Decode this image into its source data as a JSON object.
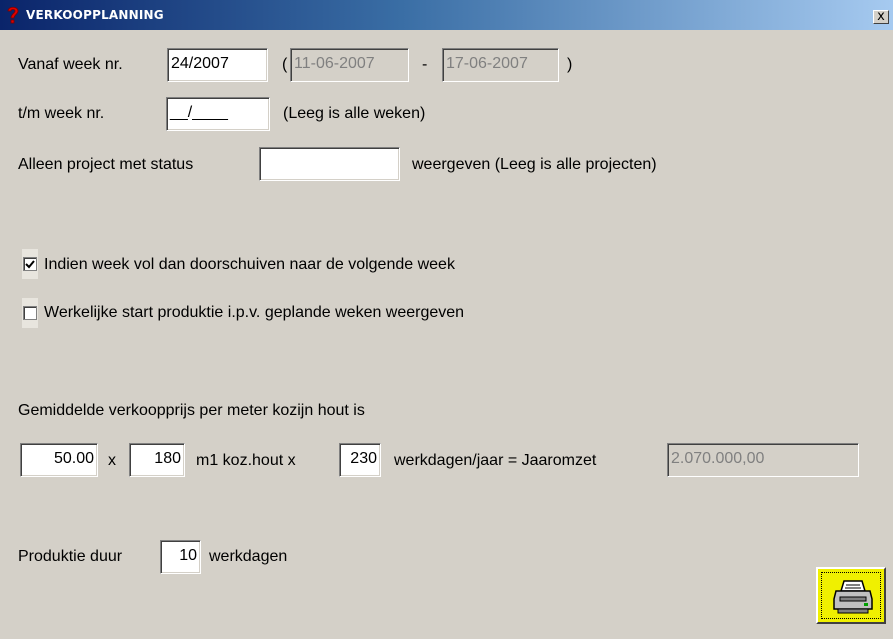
{
  "window": {
    "title": "VERKOOPPLANNING",
    "close_label": "x"
  },
  "week_from": {
    "label": "Vanaf week nr.",
    "value": "24/2007",
    "paren_open": "(",
    "date_start": "11-06-2007",
    "dash": "-",
    "date_end": "17-06-2007",
    "paren_close": ")"
  },
  "week_to": {
    "label": "t/m week nr.",
    "value": "__/____",
    "hint": "(Leeg is alle weken)"
  },
  "status_filter": {
    "label_before": "Alleen project met status",
    "value": "",
    "label_after": "weergeven (Leeg is alle projecten)"
  },
  "options": {
    "shift_week": {
      "label": "Indien week vol dan doorschuiven naar de volgende week",
      "checked": true
    },
    "actual_start": {
      "label": "Werkelijke start produktie i.p.v. geplande weken weergeven",
      "checked": false
    }
  },
  "revenue": {
    "heading": "Gemiddelde verkoopprijs per meter kozijn hout is",
    "price": "50.00",
    "times1": "x",
    "meters": "180",
    "meters_label": "m1 koz.hout x",
    "workdays": "230",
    "workdays_label": "werkdagen/jaar = Jaaromzet",
    "annual_revenue": "2.070.000,00"
  },
  "production": {
    "label": "Produktie duur",
    "value": "10",
    "unit": "werkdagen"
  },
  "print_button": {
    "icon": "printer-icon"
  },
  "colors": {
    "background": "#d4d0c8",
    "title_bar": "#0a246a",
    "print_button": "#f0f000"
  }
}
